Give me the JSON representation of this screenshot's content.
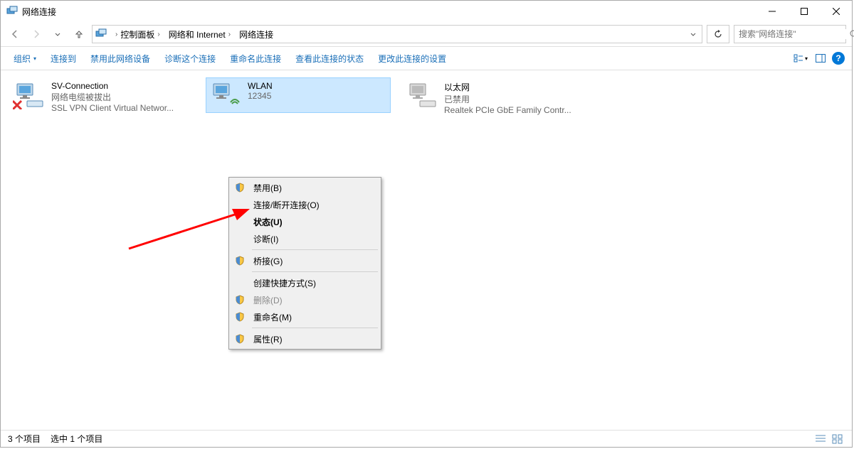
{
  "window": {
    "title": "网络连接"
  },
  "breadcrumbs": {
    "c1": "控制面板",
    "c2": "网络和 Internet",
    "c3": "网络连接"
  },
  "search": {
    "placeholder": "搜索\"网络连接\""
  },
  "toolbar": {
    "organize": "组织",
    "connect": "连接到",
    "disable": "禁用此网络设备",
    "diagnose": "诊断这个连接",
    "rename": "重命名此连接",
    "viewstatus": "查看此连接的状态",
    "changesettings": "更改此连接的设置"
  },
  "adapters": {
    "a1": {
      "name": "SV-Connection",
      "status": "网络电缆被拔出",
      "detail": "SSL VPN Client Virtual Networ..."
    },
    "a2": {
      "name": "WLAN",
      "status": "12345",
      "detail": ""
    },
    "a3": {
      "name": "以太网",
      "status": "已禁用",
      "detail": "Realtek PCIe GbE Family Contr..."
    }
  },
  "contextmenu": {
    "disable": "禁用(B)",
    "connectdisconnect": "连接/断开连接(O)",
    "status": "状态(U)",
    "diagnose": "诊断(I)",
    "bridge": "桥接(G)",
    "shortcut": "创建快捷方式(S)",
    "delete": "删除(D)",
    "rename": "重命名(M)",
    "properties": "属性(R)"
  },
  "statusbar": {
    "count": "3 个项目",
    "selected": "选中 1 个项目"
  }
}
